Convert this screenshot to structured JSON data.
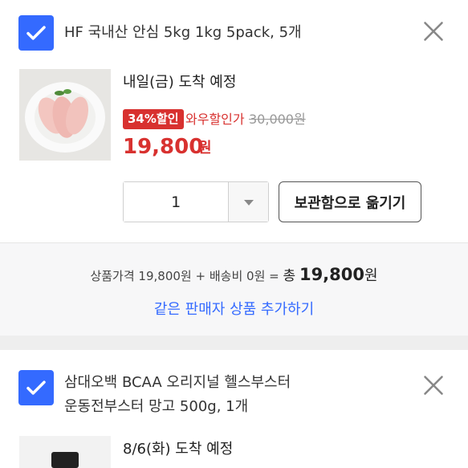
{
  "items": [
    {
      "title": "HF 국내산 안심 5kg 1kg 5pack, 5개",
      "arrival": "내일(금) 도착 예정",
      "discount_badge": "34%할인",
      "sale_label": "와우할인가",
      "original_price": "30,000원",
      "price": "19,800",
      "price_unit": "원",
      "quantity": "1",
      "move_button": "보관함으로 옮기기",
      "checked": true
    },
    {
      "title_line1": "삼대오백 BCAA 오리지널 헬스부스터",
      "title_line2": "운동전부스터 망고 500g, 1개",
      "arrival": "8/6(화) 도착 예정",
      "checked": true
    }
  ],
  "summary": {
    "product_price_label": "상품가격",
    "product_price": "19,800원",
    "plus": "+",
    "shipping_label": "배송비",
    "shipping": "0원",
    "equals": "=",
    "total_label": "총",
    "total": "19,800",
    "total_unit": "원",
    "add_link": "같은 판매자 상품 추가하기"
  },
  "colors": {
    "accent": "#346aff",
    "sale": "#d8312f"
  },
  "icons": {
    "checkbox": "checkmark-icon",
    "close": "close-icon",
    "dropdown": "chevron-down-icon"
  }
}
